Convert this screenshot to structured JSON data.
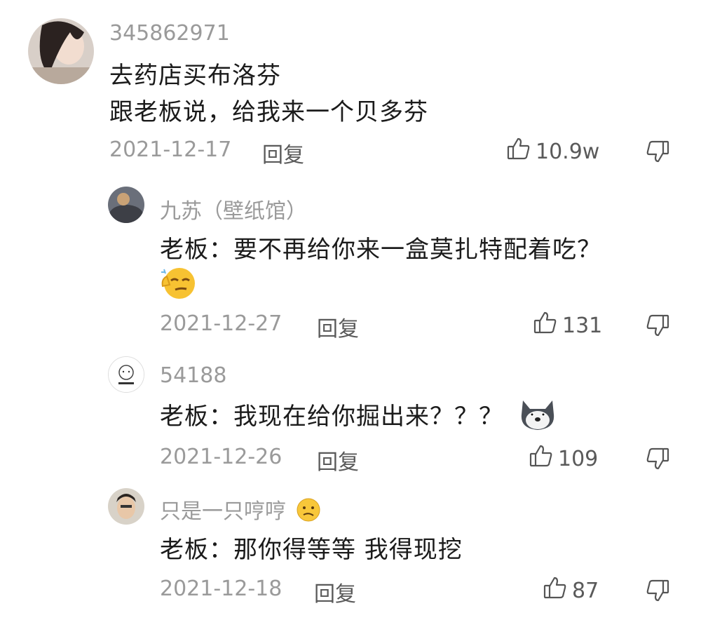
{
  "comments": [
    {
      "username": "345862971",
      "lines": [
        "去药店买布洛芬",
        "跟老板说，给我来一个贝多芬"
      ],
      "date": "2021-12-17",
      "reply_label": "回复",
      "likes": "10.9w"
    },
    {
      "username": "九苏（壁纸馆）",
      "lines": [
        "老板：要不再给你来一盒莫扎特配着吃？"
      ],
      "date": "2021-12-27",
      "reply_label": "回复",
      "likes": "131",
      "trailing_emoji": "smirk-emoji"
    },
    {
      "username": "54188",
      "lines": [
        "老板：我现在给你掘出来？？？"
      ],
      "date": "2021-12-26",
      "reply_label": "回复",
      "likes": "109",
      "trailing_emoji": "doge-emoji"
    },
    {
      "username": "只是一只哼哼",
      "username_emoji": "confused-emoji",
      "lines": [
        "老板：那你得等等 我得现挖"
      ],
      "date": "2021-12-18",
      "reply_label": "回复",
      "likes": "87"
    }
  ],
  "colors": {
    "meta": "#9a9a9a",
    "text": "#1b1b1b",
    "icon": "#555555"
  }
}
